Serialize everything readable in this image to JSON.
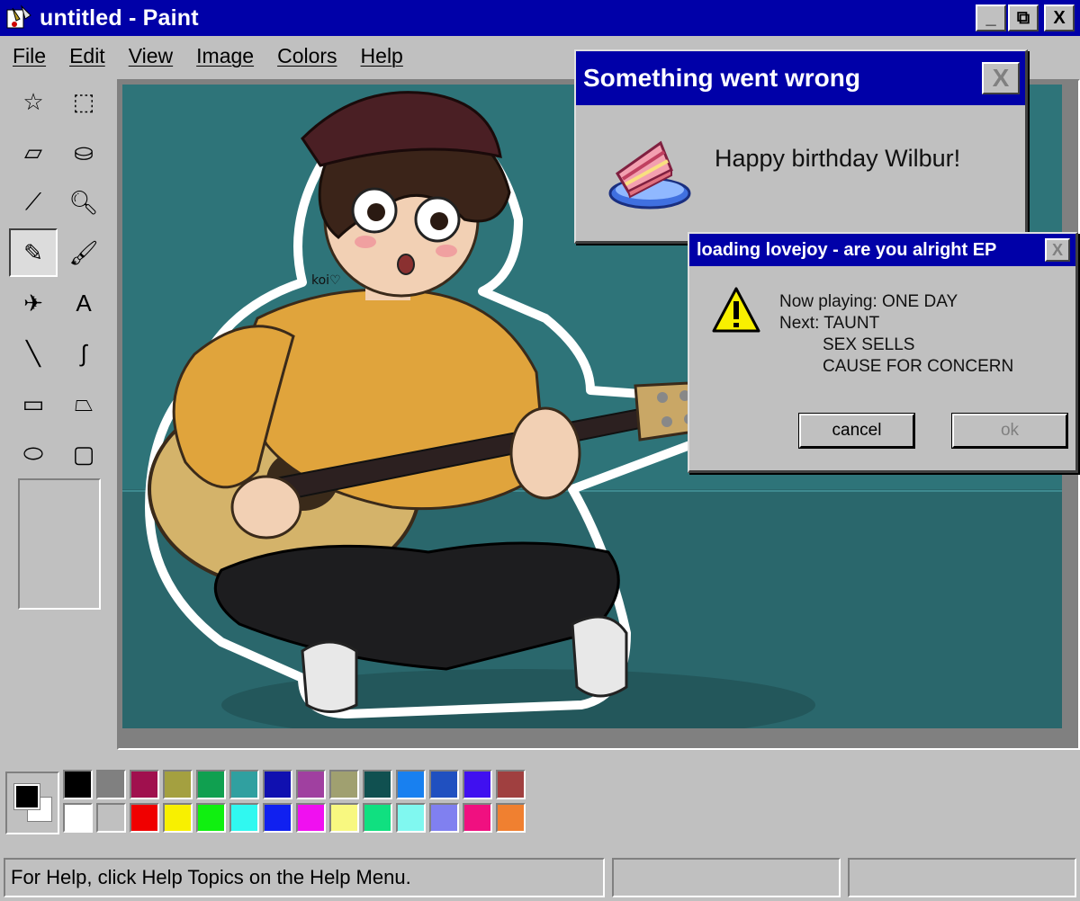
{
  "window": {
    "title": "untitled - Paint",
    "controls": {
      "minimize": "_",
      "maximize": "⧉",
      "close": "X"
    }
  },
  "menu": [
    "File",
    "Edit",
    "View",
    "Image",
    "Colors",
    "Help"
  ],
  "tools": [
    {
      "icon": "free-select-icon",
      "glyph": "☆"
    },
    {
      "icon": "rect-select-icon",
      "glyph": "⬚"
    },
    {
      "icon": "eraser-icon",
      "glyph": "▱"
    },
    {
      "icon": "fill-bucket-icon",
      "glyph": "⛀"
    },
    {
      "icon": "color-picker-icon",
      "glyph": "⟋"
    },
    {
      "icon": "magnifier-icon",
      "glyph": "🔍︎"
    },
    {
      "icon": "pencil-icon",
      "glyph": "✎",
      "active": true
    },
    {
      "icon": "brush-icon",
      "glyph": "🖌︎"
    },
    {
      "icon": "airbrush-icon",
      "glyph": "✈"
    },
    {
      "icon": "text-icon",
      "glyph": "A"
    },
    {
      "icon": "line-icon",
      "glyph": "╲"
    },
    {
      "icon": "curve-icon",
      "glyph": "∫"
    },
    {
      "icon": "rectangle-icon",
      "glyph": "▭"
    },
    {
      "icon": "polygon-icon",
      "glyph": "⏢"
    },
    {
      "icon": "ellipse-icon",
      "glyph": "⬭"
    },
    {
      "icon": "rounded-rect-icon",
      "glyph": "▢"
    }
  ],
  "palette": {
    "foreground": "#000000",
    "background": "#ffffff",
    "colors": [
      "#000000",
      "#808080",
      "#a0104e",
      "#a4a040",
      "#10a050",
      "#30a0a0",
      "#1010b0",
      "#a040a0",
      "#a0a070",
      "#105050",
      "#1880f0",
      "#2050c0",
      "#4010f0",
      "#a04040",
      "#ffffff",
      "#c0c0c0",
      "#f00000",
      "#f8f000",
      "#10f010",
      "#30f8f0",
      "#1020f0",
      "#f010f0",
      "#f8f880",
      "#10e080",
      "#80f8f0",
      "#8080f0",
      "#f01080",
      "#f08030"
    ]
  },
  "status": {
    "help": "For Help, click Help Topics on the Help Menu.",
    "pane2": "",
    "pane3": ""
  },
  "dialog_birthday": {
    "title": "Something went wrong",
    "close": "X",
    "message": "Happy birthday Wilbur!",
    "icon": "cake-icon"
  },
  "dialog_lovejoy": {
    "title": "loading lovejoy - are you alright EP",
    "close": "X",
    "icon": "warning-icon",
    "line1": "Now playing: ONE DAY",
    "line2": "Next: TAUNT",
    "line3": "SEX SELLS",
    "line4": "CAUSE FOR CONCERN",
    "cancel": "cancel",
    "ok": "ok"
  },
  "artwork": {
    "signature": "koi♡"
  }
}
